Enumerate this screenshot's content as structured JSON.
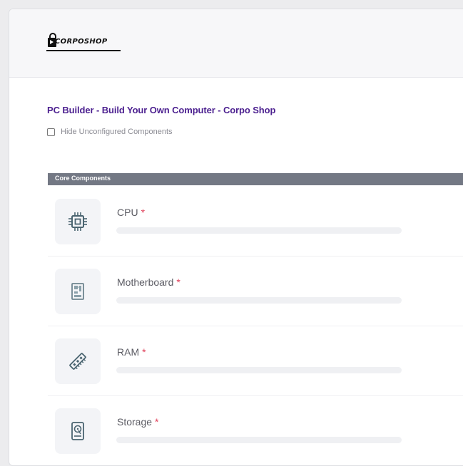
{
  "header": {
    "logo_text": "CORPOSHOP"
  },
  "page": {
    "title": "PC Builder - Build Your Own Computer - Corpo Shop",
    "hide_unconfigured_label": "Hide Unconfigured Components",
    "hide_unconfigured_checked": false
  },
  "sections": [
    {
      "label": "Core Components",
      "components": [
        {
          "name": "CPU",
          "required_mark": "*",
          "icon": "cpu-icon",
          "progress": 0
        },
        {
          "name": "Motherboard",
          "required_mark": "*",
          "icon": "motherboard-icon",
          "progress": 0
        },
        {
          "name": "RAM",
          "required_mark": "*",
          "icon": "ram-icon",
          "progress": 0
        },
        {
          "name": "Storage",
          "required_mark": "*",
          "icon": "storage-icon",
          "progress": 0
        }
      ]
    }
  ],
  "colors": {
    "title": "#4b1f8f",
    "section_bar": "#737884",
    "required": "#e0405a",
    "icon_stroke": "#4a6470"
  }
}
